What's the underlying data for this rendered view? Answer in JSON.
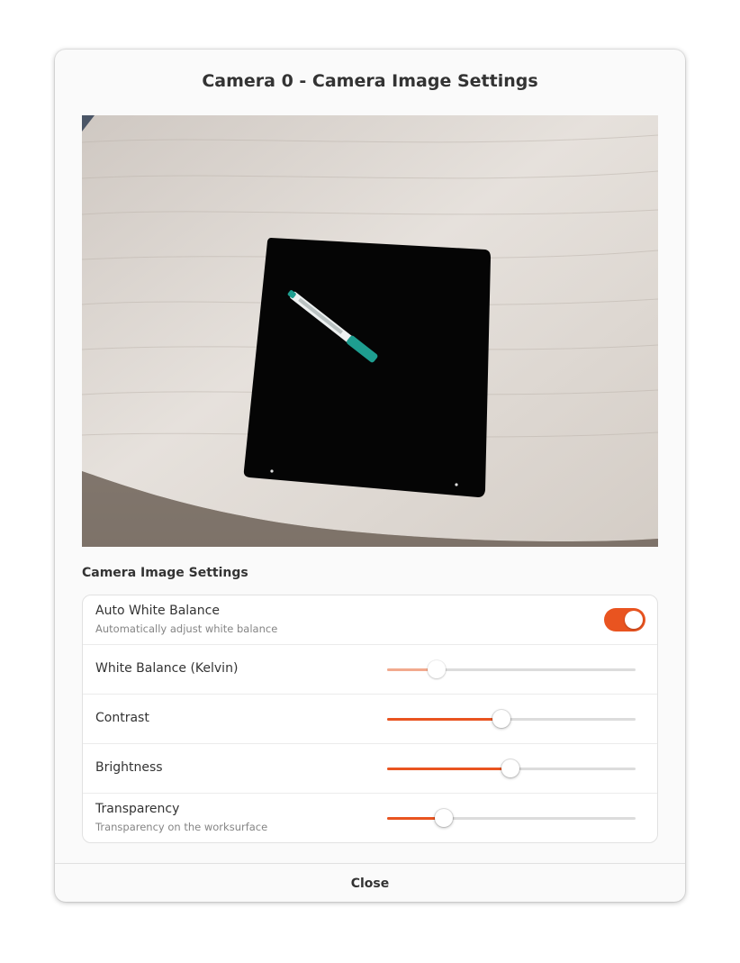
{
  "dialog": {
    "title": "Camera 0 - Camera Image Settings",
    "close_label": "Close"
  },
  "preview": {
    "pen_label": "permanent marker"
  },
  "settings": {
    "section_title": "Camera Image Settings",
    "accent_color": "#e95420",
    "disabled_accent_color": "#f2aa8e",
    "auto_white_balance": {
      "label": "Auto White Balance",
      "subtitle": "Automatically adjust white balance",
      "enabled": true
    },
    "sliders": [
      {
        "key": "white_balance",
        "label": "White Balance (Kelvin)",
        "subtitle": "",
        "value": 0.2,
        "disabled": true
      },
      {
        "key": "contrast",
        "label": "Contrast",
        "subtitle": "",
        "value": 0.46,
        "disabled": false
      },
      {
        "key": "brightness",
        "label": "Brightness",
        "subtitle": "",
        "value": 0.495,
        "disabled": false
      },
      {
        "key": "transparency",
        "label": "Transparency",
        "subtitle": "Transparency on the worksurface",
        "value": 0.23,
        "disabled": false
      }
    ]
  }
}
